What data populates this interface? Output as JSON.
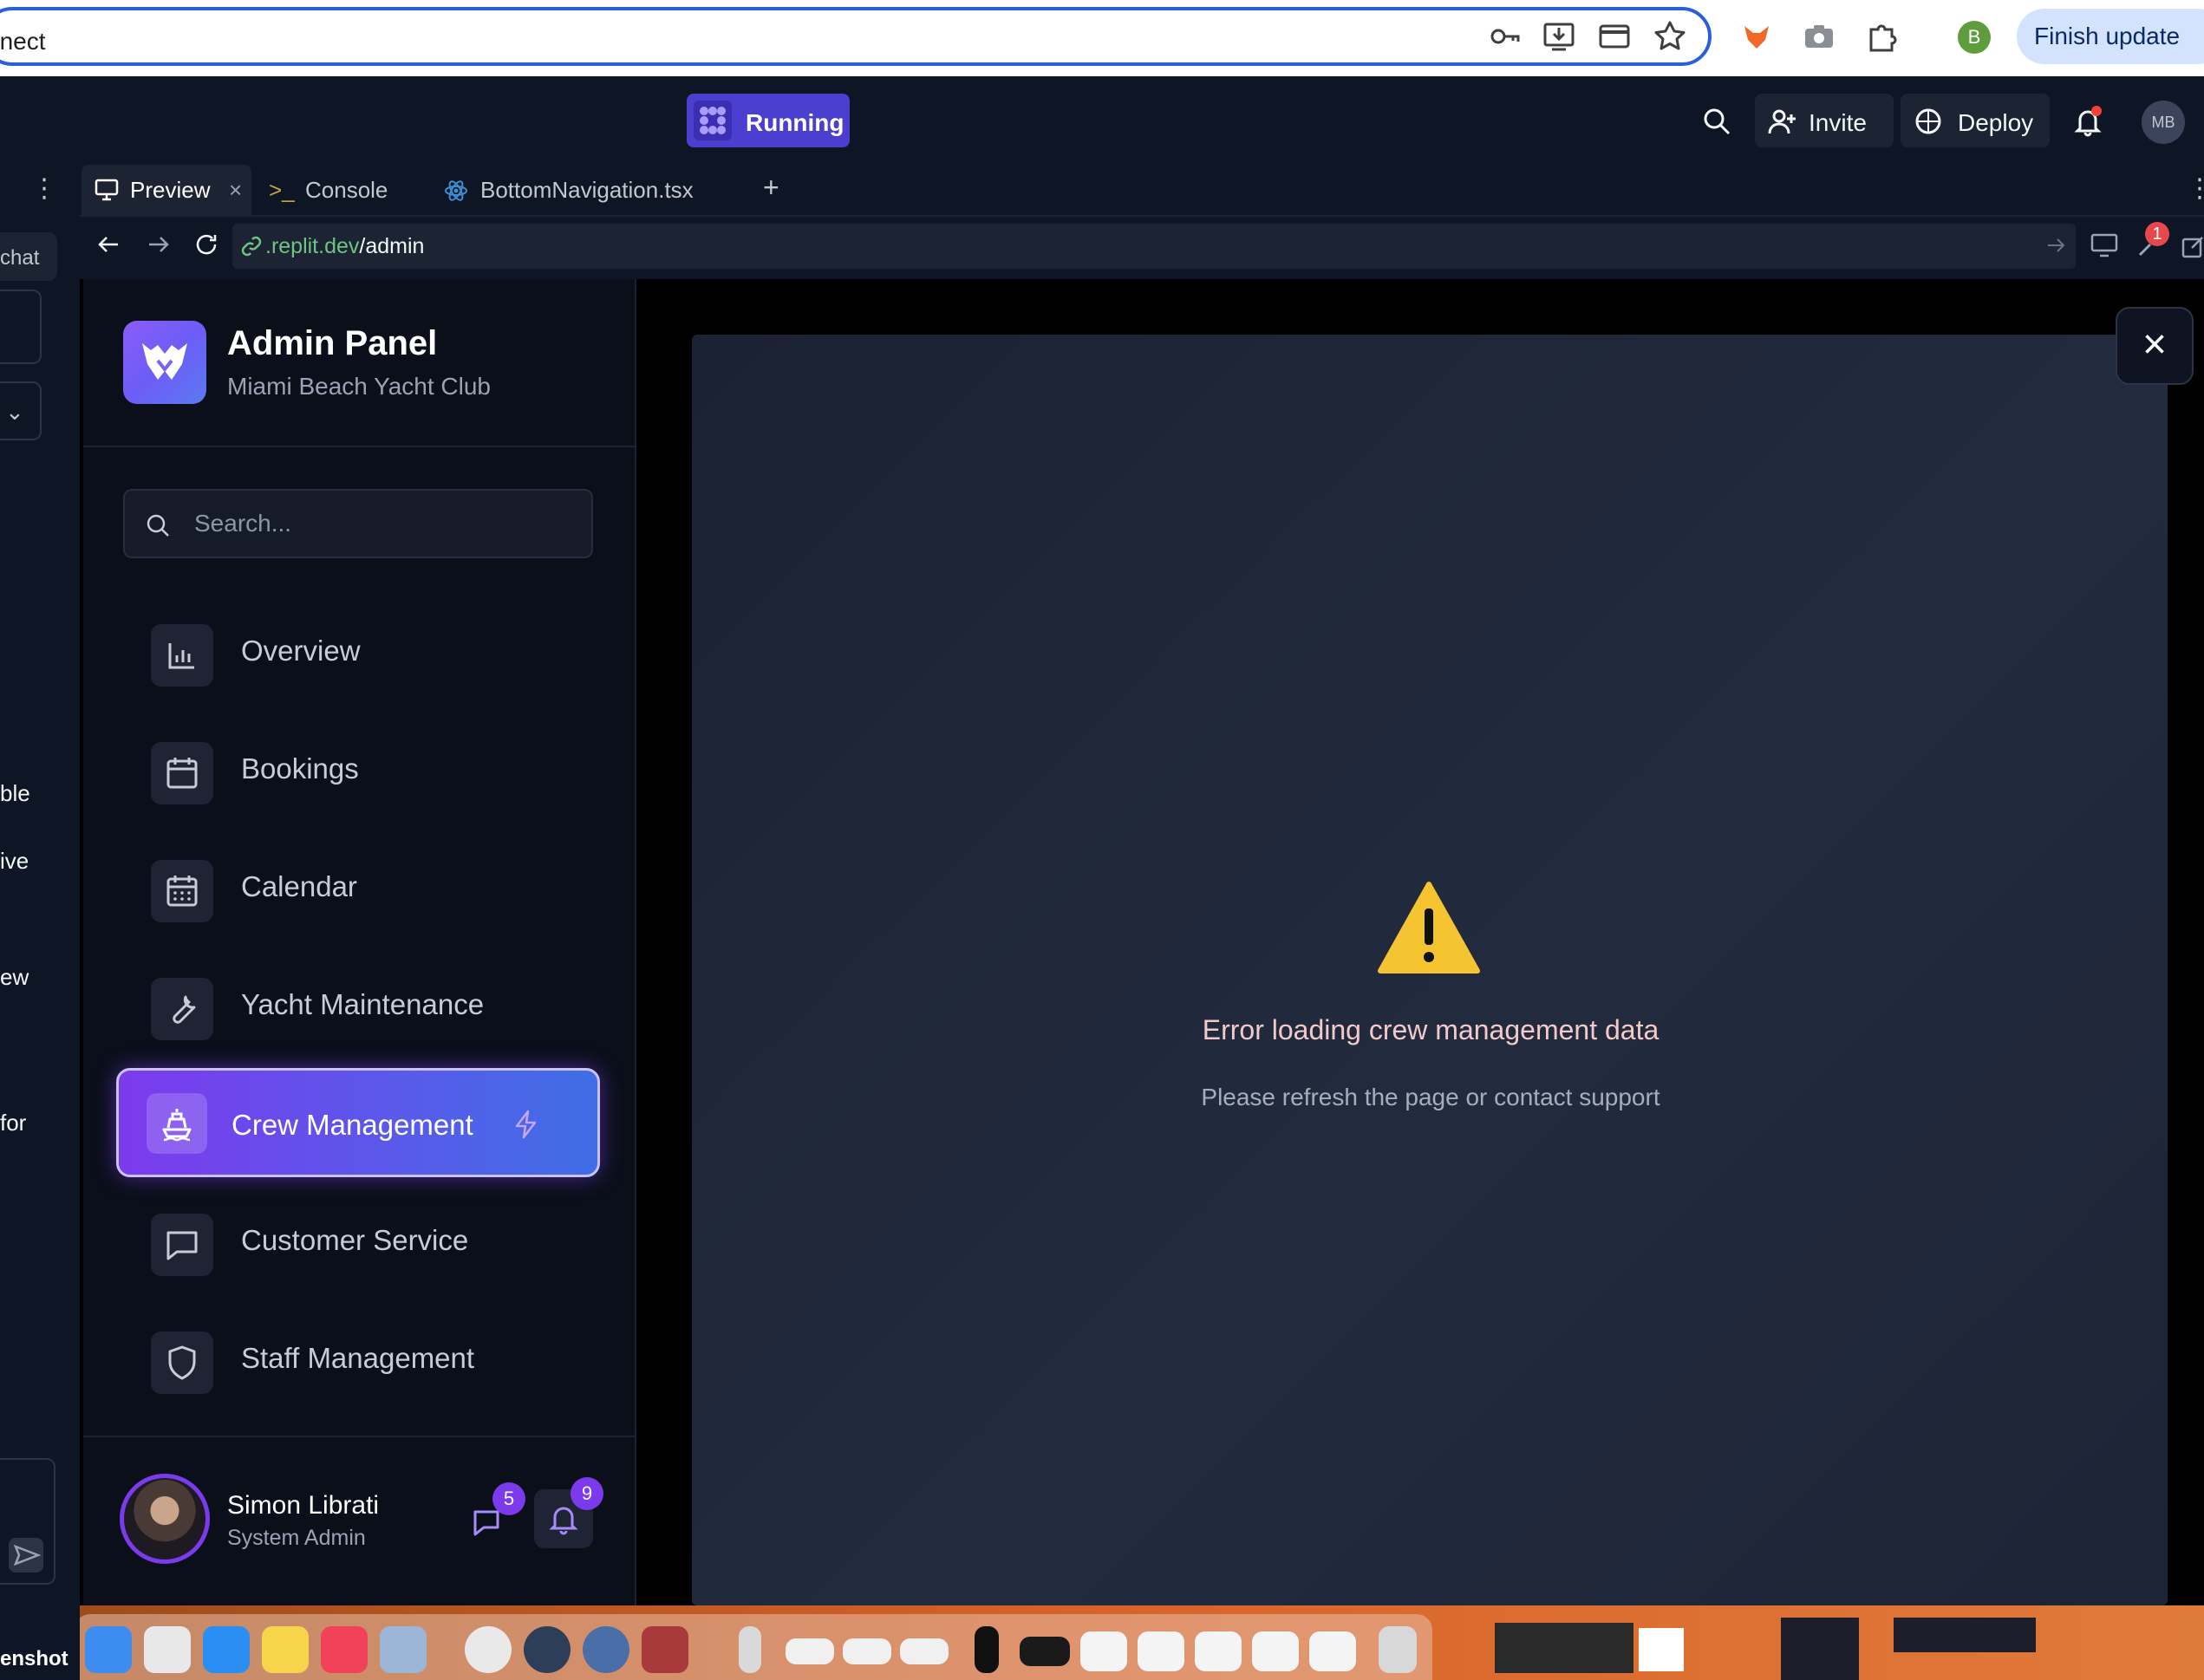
{
  "browser": {
    "url_partial": "nnect",
    "finish_update": "Finish update",
    "profile_initial": "B"
  },
  "replit_header": {
    "run_label": "Running",
    "invite_label": "Invite",
    "deploy_label": "Deploy",
    "avatar_initials": "MB"
  },
  "left_strip": {
    "chat_label": "chat",
    "fragments": [
      "ble",
      "ive",
      "ew",
      "for"
    ],
    "screenshot_label": "enshot"
  },
  "tabs": [
    {
      "label": "Preview"
    },
    {
      "label": "Console"
    },
    {
      "label": "BottomNavigation.tsx"
    }
  ],
  "preview_url": {
    "host": ".replit.dev",
    "path": "/admin"
  },
  "devtools_badge": "1",
  "brand": {
    "title": "Admin Panel",
    "subtitle": "Miami Beach Yacht Club"
  },
  "search": {
    "placeholder": "Search..."
  },
  "nav": {
    "items": [
      {
        "label": "Overview",
        "icon": "bar-chart-icon"
      },
      {
        "label": "Bookings",
        "icon": "calendar-icon"
      },
      {
        "label": "Calendar",
        "icon": "calendar-grid-icon"
      },
      {
        "label": "Yacht Maintenance",
        "icon": "wrench-icon"
      },
      {
        "label": "Crew Management",
        "icon": "ship-icon",
        "active": true
      },
      {
        "label": "Customer Service",
        "icon": "message-icon"
      },
      {
        "label": "Staff Management",
        "icon": "shield-icon"
      }
    ]
  },
  "user": {
    "name": "Simon Librati",
    "role": "System Admin",
    "messages_count": "5",
    "notifications_count": "9"
  },
  "error": {
    "title": "Error loading crew management data",
    "subtitle": "Please refresh the page or contact support"
  },
  "colors": {
    "accent": "#7c3aed",
    "active_gradient_end": "#3f6ee6",
    "replit_run": "#4b3fcf"
  }
}
